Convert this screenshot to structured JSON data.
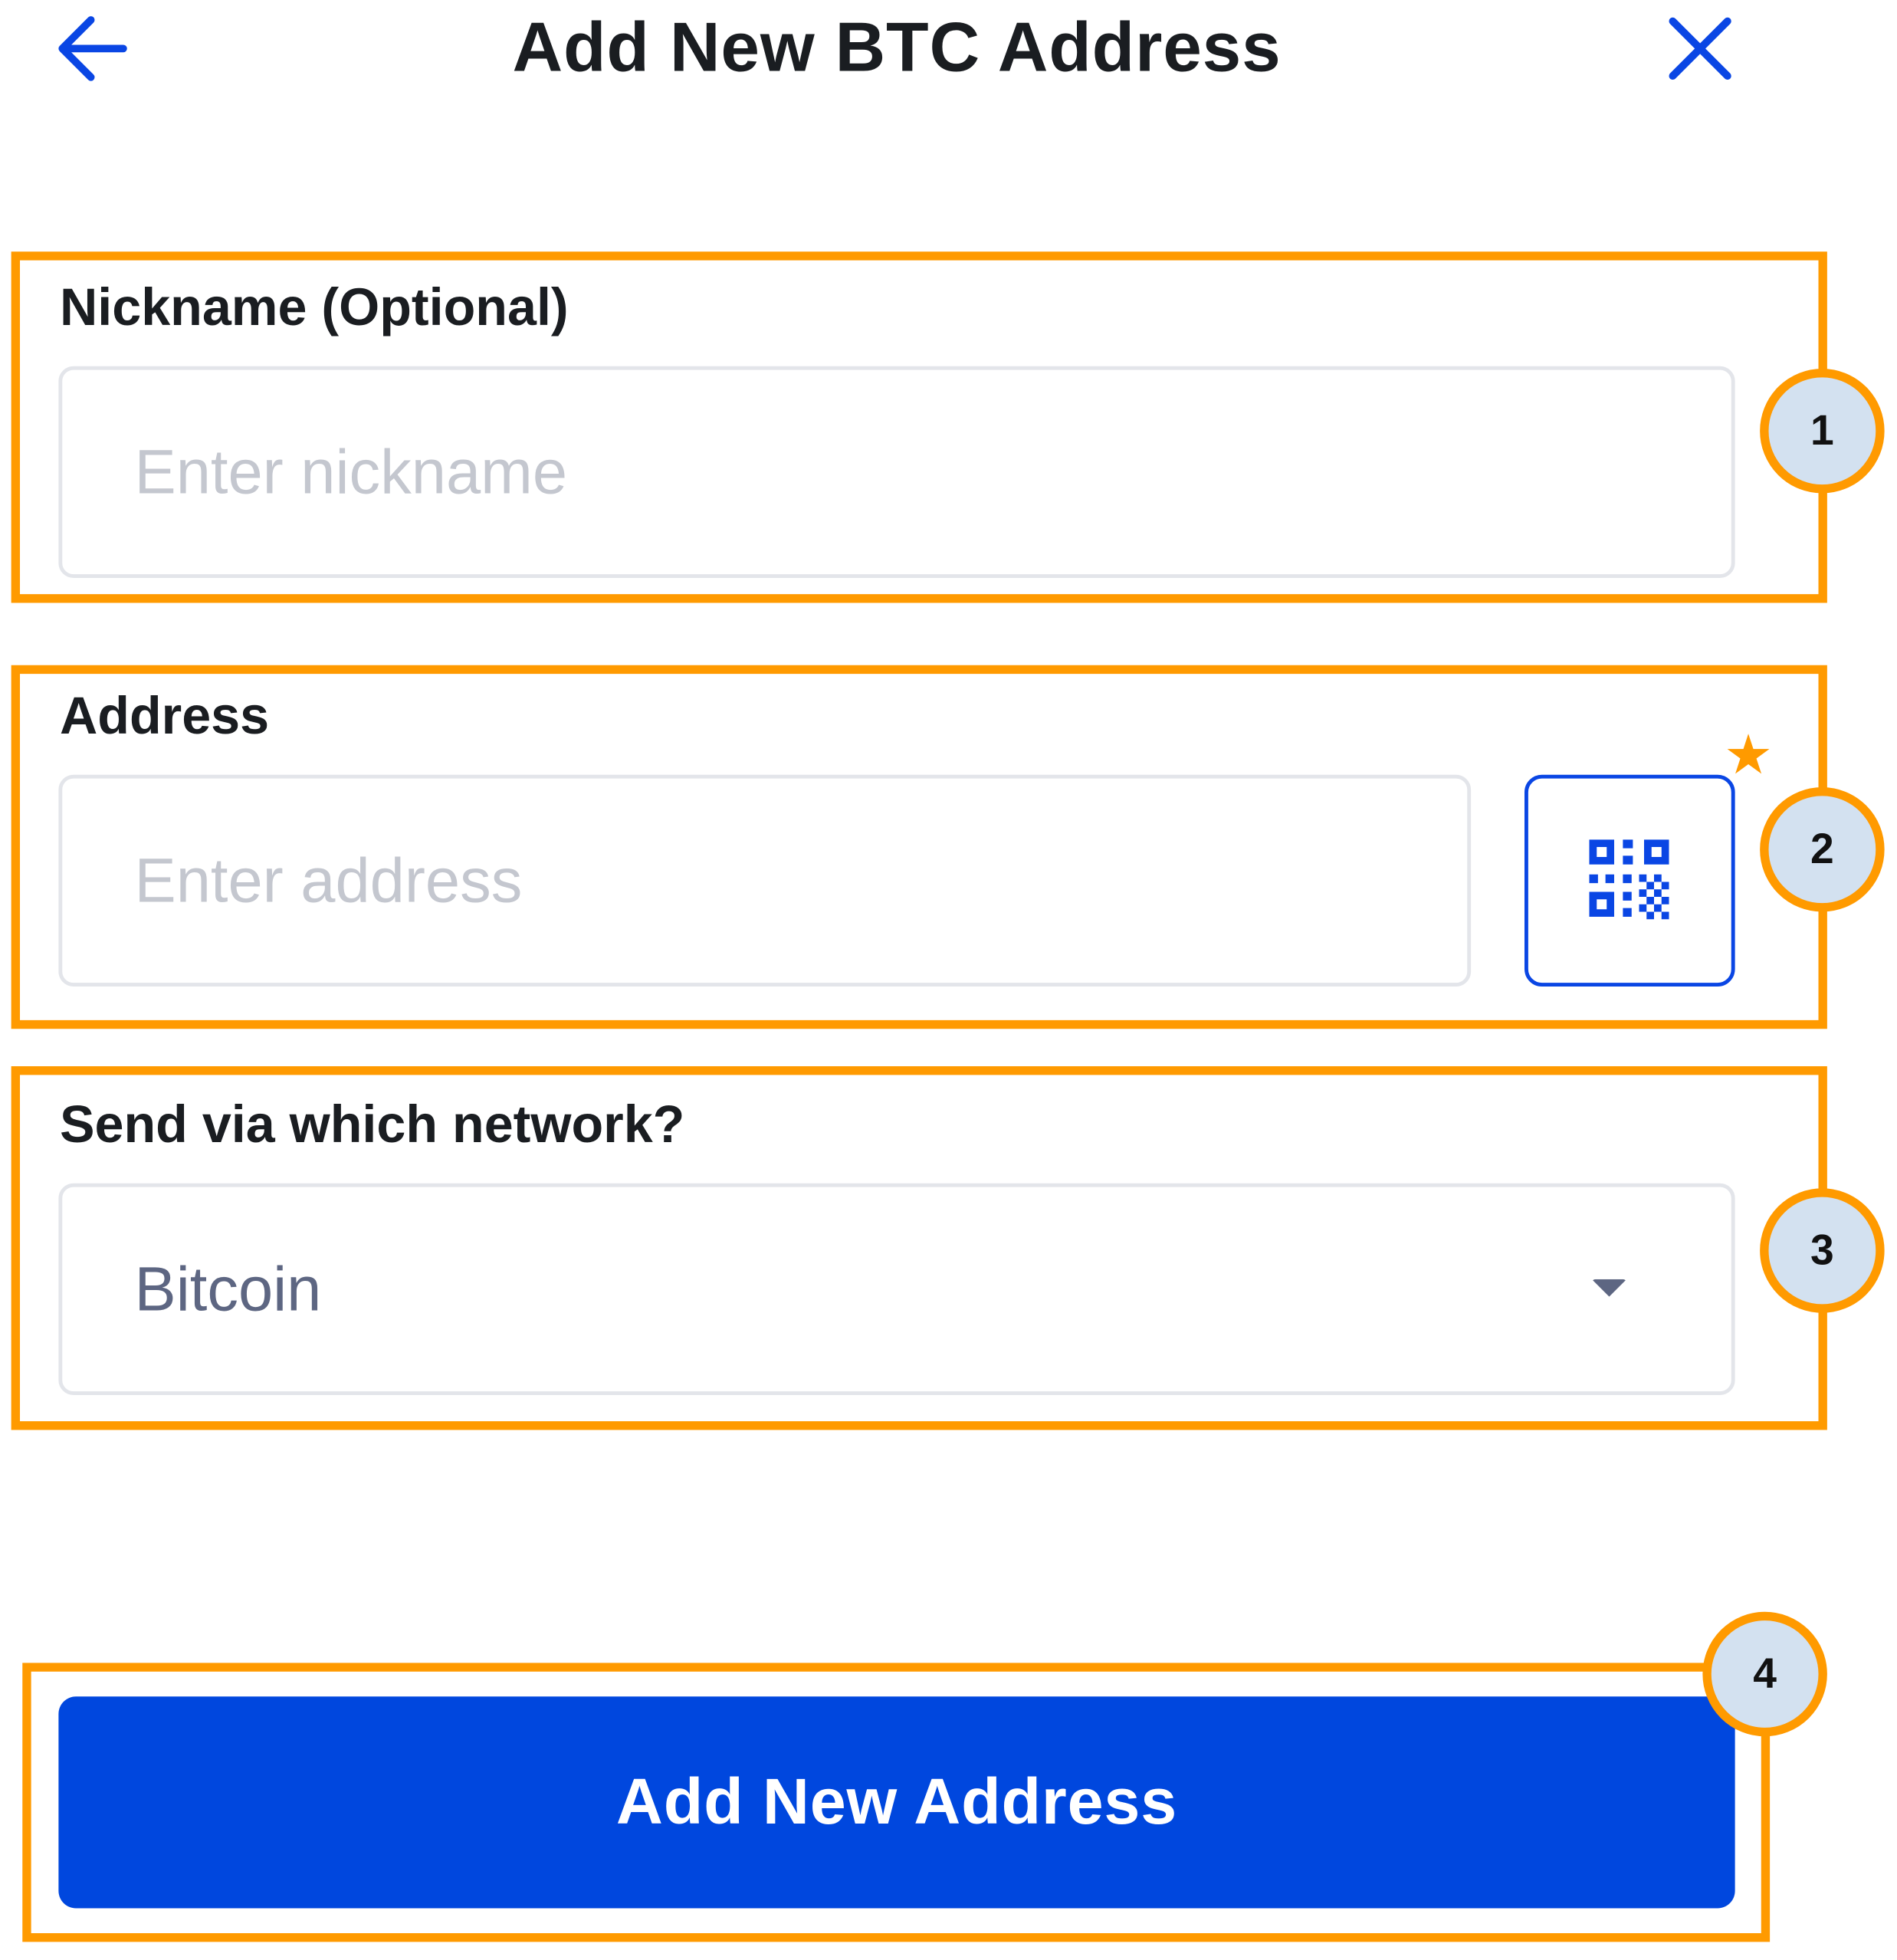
{
  "header": {
    "title": "Add New BTC Address",
    "back_icon": "arrow-left-icon",
    "close_icon": "close-icon"
  },
  "form": {
    "nickname": {
      "label": "Nickname (Optional)",
      "placeholder": "Enter nickname",
      "value": ""
    },
    "address": {
      "label": "Address",
      "placeholder": "Enter address",
      "value": "",
      "scan_icon": "qr-code-icon"
    },
    "network": {
      "label": "Send via which network?",
      "selected": "Bitcoin",
      "caret_icon": "caret-down-icon"
    },
    "submit_label": "Add New Address"
  },
  "annotations": {
    "badges": [
      "1",
      "2",
      "3",
      "4"
    ],
    "star": "★"
  },
  "colors": {
    "accent": "#0047de",
    "highlight": "#ff9a00",
    "badge_fill": "#d3e1f0",
    "placeholder": "#c4c7cf",
    "select_text": "#5d6682"
  }
}
